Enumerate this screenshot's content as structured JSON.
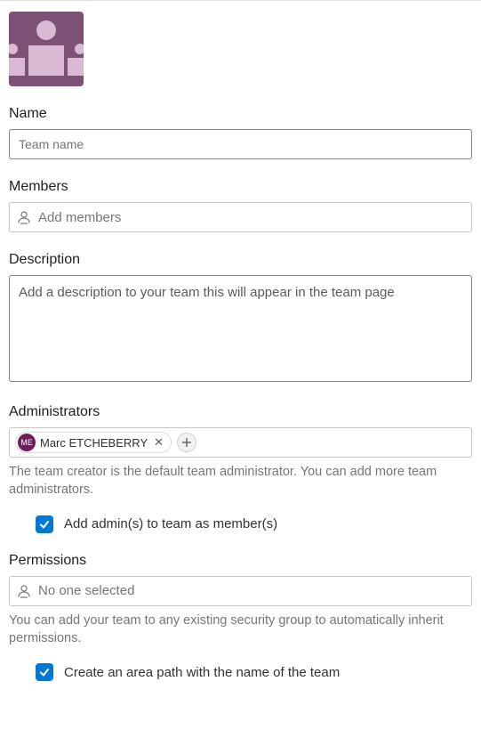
{
  "form": {
    "avatar": {
      "initials": ""
    },
    "name": {
      "label": "Name",
      "placeholder": "Team name",
      "value": ""
    },
    "members": {
      "label": "Members",
      "placeholder": "Add members"
    },
    "description": {
      "label": "Description",
      "placeholder": "Add a description to your team this will appear in the team page",
      "value": ""
    },
    "administrators": {
      "label": "Administrators",
      "chips": [
        {
          "initials": "ME",
          "name": "Marc ETCHEBERRY"
        }
      ],
      "helper": "The team creator is the default team administrator. You can add more team administrators.",
      "add_as_members": {
        "checked": true,
        "label": "Add admin(s) to team as member(s)"
      }
    },
    "permissions": {
      "label": "Permissions",
      "placeholder": "No one selected",
      "helper": "You can add your team to any existing security group to automatically inherit permissions.",
      "create_area_path": {
        "checked": true,
        "label": "Create an area path with the name of the team"
      }
    }
  }
}
